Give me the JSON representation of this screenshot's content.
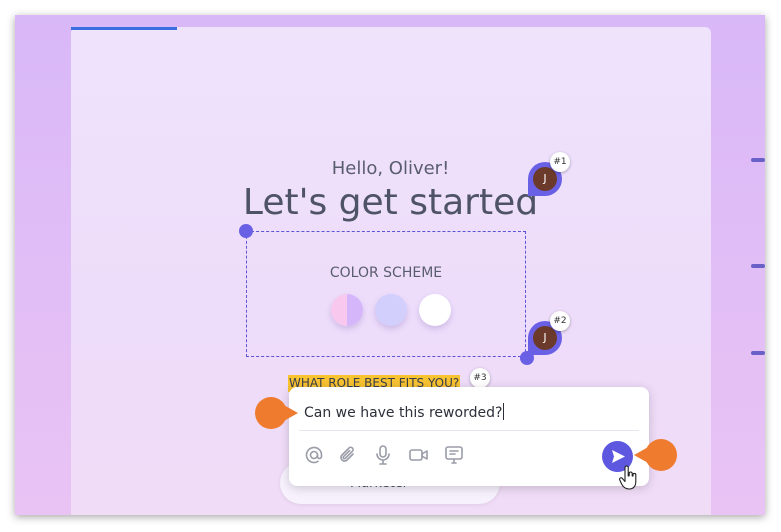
{
  "greeting": "Hello, Oliver!",
  "heading": "Let's get started",
  "color_scheme": {
    "label": "COLOR SCHEME",
    "options": [
      "lavender-pink",
      "lavender",
      "white"
    ]
  },
  "comment_pins": [
    {
      "number": "#1",
      "avatar_initial": "J"
    },
    {
      "number": "#2",
      "avatar_initial": "J"
    }
  ],
  "highlight": {
    "text": "WHAT ROLE BEST FITS YOU?",
    "number": "#3"
  },
  "option_pill": {
    "label": "Marketer"
  },
  "comment_box": {
    "text": "Can we have this reworded?",
    "tools": [
      "mention-icon",
      "attach-icon",
      "mic-icon",
      "video-icon",
      "screen-icon"
    ],
    "send_icon": "send-icon"
  },
  "colors": {
    "accent": "#5e58e0",
    "highlight": "#f7c331",
    "callout": "#ef7b2f",
    "progress": "#3a6fe0"
  }
}
